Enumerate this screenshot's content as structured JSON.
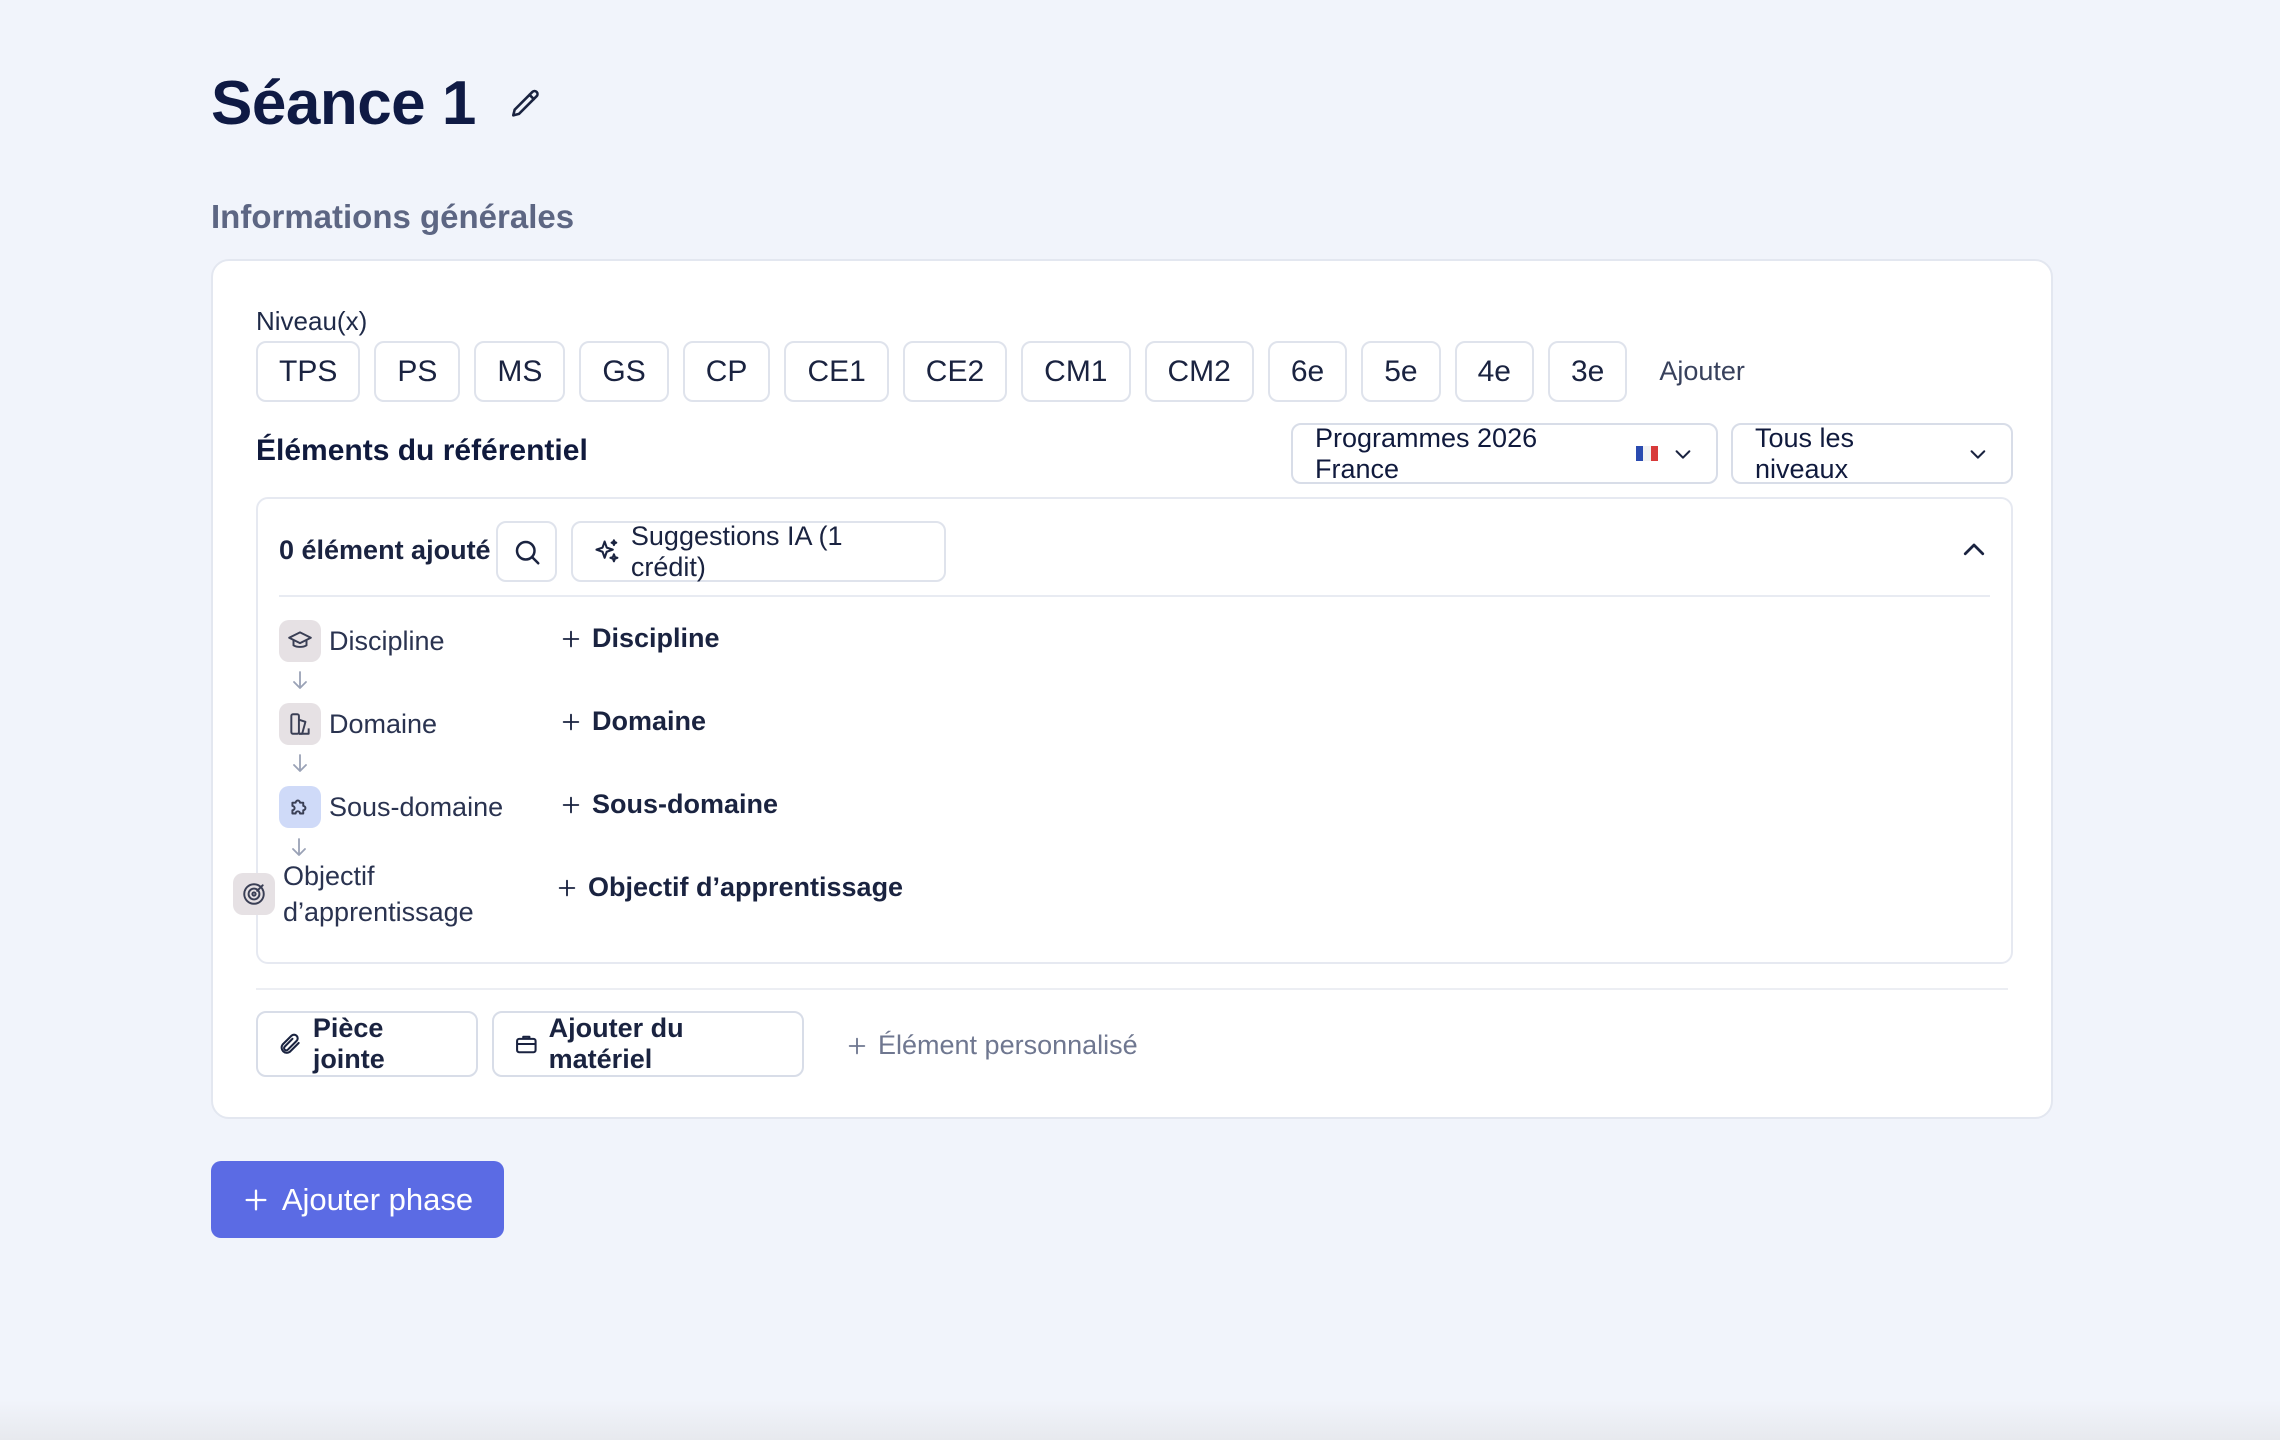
{
  "header": {
    "title": "Séance 1",
    "edit_icon": "pencil-icon"
  },
  "general_info": {
    "section_label": "Informations générales",
    "niveau_label": "Niveau(x)",
    "levels": [
      "TPS",
      "PS",
      "MS",
      "GS",
      "CP",
      "CE1",
      "CE2",
      "CM1",
      "CM2",
      "6e",
      "5e",
      "4e",
      "3e"
    ],
    "add_level_label": "Ajouter"
  },
  "referentiel": {
    "title": "Éléments du référentiel",
    "program_dropdown": "Programmes 2026 France",
    "program_flag": "france-flag-icon",
    "levels_dropdown": "Tous les niveaux",
    "count_text": "0 élément ajouté",
    "ai_button": "Suggestions IA (1 crédit)",
    "hierarchy": [
      {
        "label": "Discipline",
        "add_label": "Discipline",
        "icon": "graduation-cap-icon"
      },
      {
        "label": "Domaine",
        "add_label": "Domaine",
        "icon": "domain-icon"
      },
      {
        "label": "Sous-domaine",
        "add_label": "Sous-domaine",
        "icon": "puzzle-icon"
      },
      {
        "label_line1": "Objectif",
        "label_line2": "d’apprentissage",
        "add_label": "Objectif d’apprentissage",
        "icon": "target-icon"
      }
    ]
  },
  "footer_actions": {
    "attachment": "Pièce jointe",
    "material": "Ajouter du matériel",
    "custom_element": "Élément personnalisé"
  },
  "add_phase_button": "Ajouter phase",
  "colors": {
    "accent": "#5b6be4",
    "page_bg": "#f1f4fb",
    "title": "#0f1a44"
  }
}
